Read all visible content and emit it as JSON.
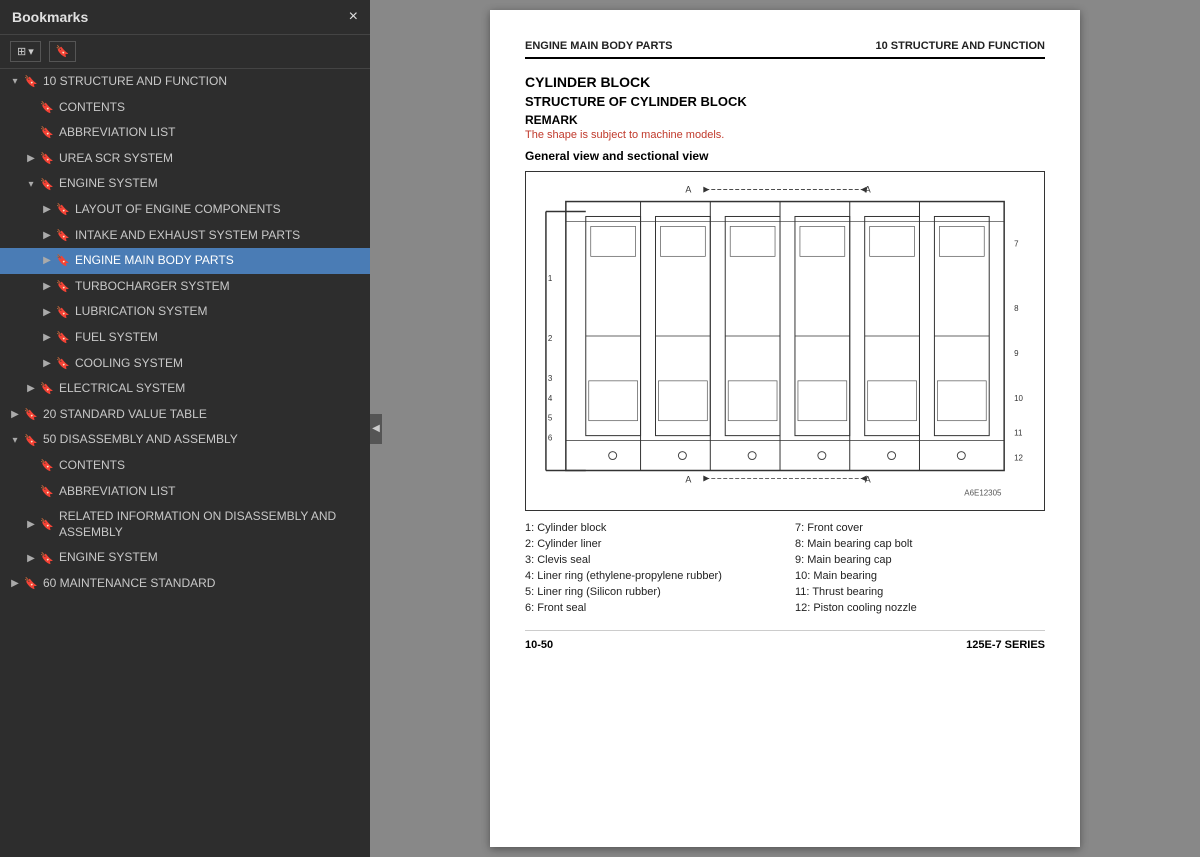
{
  "sidebar": {
    "title": "Bookmarks",
    "close_label": "×",
    "toolbar": {
      "view_btn": "⊞▾",
      "bookmark_btn": "🔖"
    },
    "tree": [
      {
        "id": "s1",
        "label": "10 STRUCTURE AND FUNCTION",
        "indent": 0,
        "toggle": "▾",
        "expanded": true,
        "type": "section"
      },
      {
        "id": "s1-1",
        "label": "CONTENTS",
        "indent": 1,
        "toggle": "",
        "expanded": false,
        "type": "leaf"
      },
      {
        "id": "s1-2",
        "label": "ABBREVIATION LIST",
        "indent": 1,
        "toggle": "",
        "expanded": false,
        "type": "leaf"
      },
      {
        "id": "s1-3",
        "label": "UREA SCR SYSTEM",
        "indent": 1,
        "toggle": "▶",
        "expanded": false,
        "type": "node"
      },
      {
        "id": "s1-4",
        "label": "ENGINE SYSTEM",
        "indent": 1,
        "toggle": "▾",
        "expanded": true,
        "type": "node"
      },
      {
        "id": "s1-4-1",
        "label": "LAYOUT OF ENGINE COMPONENTS",
        "indent": 2,
        "toggle": "▶",
        "expanded": false,
        "type": "node"
      },
      {
        "id": "s1-4-2",
        "label": "INTAKE AND EXHAUST SYSTEM PARTS",
        "indent": 2,
        "toggle": "▶",
        "expanded": false,
        "type": "node"
      },
      {
        "id": "s1-4-3",
        "label": "ENGINE MAIN BODY PARTS",
        "indent": 2,
        "toggle": "▶",
        "expanded": false,
        "type": "node",
        "active": true
      },
      {
        "id": "s1-4-4",
        "label": "TURBOCHARGER SYSTEM",
        "indent": 2,
        "toggle": "▶",
        "expanded": false,
        "type": "node"
      },
      {
        "id": "s1-4-5",
        "label": "LUBRICATION SYSTEM",
        "indent": 2,
        "toggle": "▶",
        "expanded": false,
        "type": "node"
      },
      {
        "id": "s1-4-6",
        "label": "FUEL SYSTEM",
        "indent": 2,
        "toggle": "▶",
        "expanded": false,
        "type": "node"
      },
      {
        "id": "s1-4-7",
        "label": "COOLING SYSTEM",
        "indent": 2,
        "toggle": "▶",
        "expanded": false,
        "type": "node"
      },
      {
        "id": "s1-5",
        "label": "ELECTRICAL SYSTEM",
        "indent": 1,
        "toggle": "▶",
        "expanded": false,
        "type": "node"
      },
      {
        "id": "s2",
        "label": "20 STANDARD VALUE TABLE",
        "indent": 0,
        "toggle": "▶",
        "expanded": false,
        "type": "section"
      },
      {
        "id": "s3",
        "label": "50 DISASSEMBLY AND ASSEMBLY",
        "indent": 0,
        "toggle": "▾",
        "expanded": true,
        "type": "section"
      },
      {
        "id": "s3-1",
        "label": "CONTENTS",
        "indent": 1,
        "toggle": "",
        "expanded": false,
        "type": "leaf"
      },
      {
        "id": "s3-2",
        "label": "ABBREVIATION LIST",
        "indent": 1,
        "toggle": "",
        "expanded": false,
        "type": "leaf"
      },
      {
        "id": "s3-3",
        "label": "RELATED INFORMATION ON DISASSEMBLY AND ASSEMBLY",
        "indent": 1,
        "toggle": "▶",
        "expanded": false,
        "type": "node"
      },
      {
        "id": "s3-4",
        "label": "ENGINE SYSTEM",
        "indent": 1,
        "toggle": "▶",
        "expanded": false,
        "type": "node"
      },
      {
        "id": "s4",
        "label": "60 MAINTENANCE STANDARD",
        "indent": 0,
        "toggle": "▶",
        "expanded": false,
        "type": "section"
      }
    ]
  },
  "document": {
    "header": {
      "left": "ENGINE MAIN BODY PARTS",
      "right": "10 STRUCTURE AND FUNCTION"
    },
    "section_title": "CYLINDER BLOCK",
    "section_subtitle": "STRUCTURE OF CYLINDER BLOCK",
    "remark_label": "REMARK",
    "remark_text": "The shape is subject to machine models.",
    "view_label": "General view and sectional view",
    "diagram_ref": "A6E12305",
    "parts": [
      {
        "left": "1: Cylinder block",
        "right": "7: Front cover"
      },
      {
        "left": "2: Cylinder liner",
        "right": "8: Main bearing cap bolt"
      },
      {
        "left": "3: Clevis seal",
        "right": "9: Main bearing cap"
      },
      {
        "left": "4: Liner ring (ethylene-propylene rubber)",
        "right": "10: Main bearing"
      },
      {
        "left": "5: Liner ring (Silicon rubber)",
        "right": "11: Thrust bearing"
      },
      {
        "left": "6: Front seal",
        "right": "12: Piston cooling nozzle"
      }
    ],
    "footer": {
      "left": "10-50",
      "right": "125E-7 SERIES"
    }
  }
}
